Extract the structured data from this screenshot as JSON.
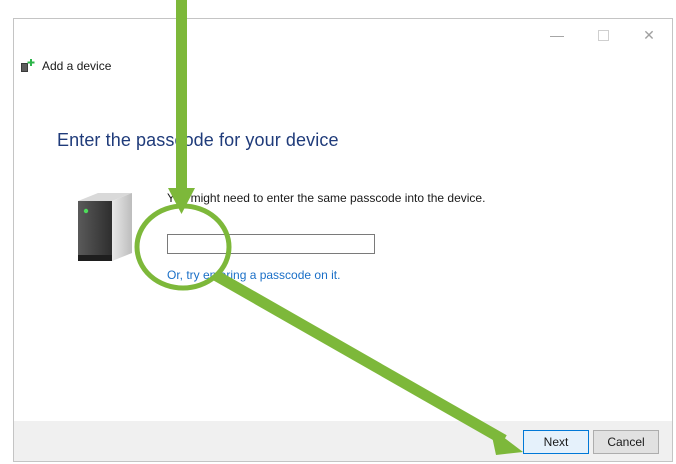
{
  "window": {
    "title": "Add a device",
    "controls": {
      "minimize": "—",
      "maximize": "",
      "close": "✕"
    }
  },
  "main": {
    "heading": "Enter the passcode for your device",
    "instruction": "You might need to enter the same passcode into the device.",
    "passcode_value": "",
    "alt_link": "Or, try entering a passcode on it."
  },
  "footer": {
    "next_label": "Next",
    "cancel_label": "Cancel"
  },
  "annotation": {
    "color": "#7db83a"
  }
}
